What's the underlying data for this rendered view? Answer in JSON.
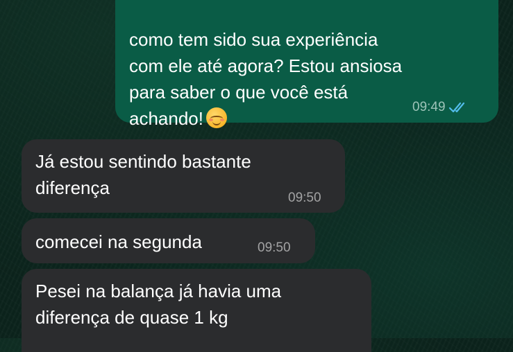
{
  "messages": [
    {
      "direction": "outgoing",
      "text": "como tem sido sua experiência\ncom ele até agora? Estou ansiosa\npara saber o que você está\nachando!",
      "emoji": "smiling-face-with-smiling-eyes",
      "time": "09:49",
      "status": "read"
    },
    {
      "direction": "incoming",
      "text": "Já estou sentindo bastante\ndiferença",
      "time": "09:50"
    },
    {
      "direction": "incoming",
      "text": "comecei na segunda",
      "time": "09:50"
    },
    {
      "direction": "incoming",
      "text": "Pesei na balança já havia uma\ndiferença de quase 1 kg",
      "time": ""
    }
  ],
  "colors": {
    "background": "#0b231c",
    "outgoing_bubble": "#0a5c46",
    "incoming_bubble": "#2b2c2e",
    "read_ticks": "#53bdeb"
  },
  "icons": {
    "read_receipt": "double-check-icon"
  }
}
